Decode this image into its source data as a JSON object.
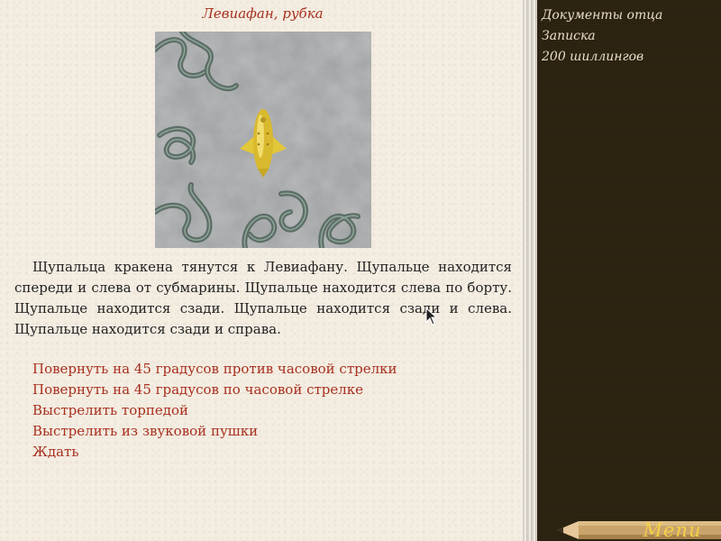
{
  "location_title": "Левиафан, рубка",
  "scene": {
    "image": "overhead view of a golden submarine in grey water surrounded by kraken tentacles",
    "icons": [
      "submarine-icon",
      "kraken-tentacle-icon"
    ]
  },
  "story_text": "Щупальца кракена тянутся к Левиафану. Щупальце находится спереди и слева от субмарины. Щупальце находится слева по борту. Щупальце находится сзади. Щупальце находится сзади и слева. Щупальце находится сзади и справа.",
  "choices": [
    "Повернуть на 45 градусов против часовой стрелки",
    "Повернуть на 45 градусов по часовой стрелке",
    "Выстрелить торпедой",
    "Выстрелить из звуковой пушки",
    "Ждать"
  ],
  "inventory": [
    "Документы отца",
    "Записка",
    "200 шиллингов"
  ],
  "menu_label": "Menu",
  "colors": {
    "accent_red": "#a8301e",
    "sidebar_bg": "#2b2211",
    "menu_gold": "#f5d04a"
  }
}
